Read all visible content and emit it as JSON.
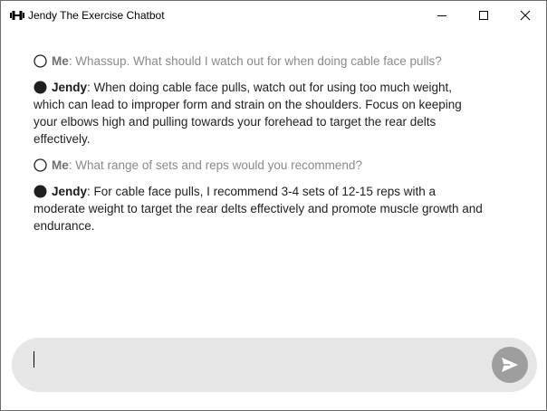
{
  "window": {
    "title": "Jendy The Exercise Chatbot"
  },
  "colors": {
    "user_text": "#8a8a8a",
    "bot_text": "#1f1f1f",
    "input_bg": "#e6e6e6",
    "send_button": "#9e9e9e"
  },
  "messages": [
    {
      "sender": "Me",
      "separator": ": ",
      "text": "Whassup. What should I watch out for when doing cable face pulls?",
      "marker": "hollow-circle-icon"
    },
    {
      "sender": "Jendy",
      "separator": ": ",
      "text": "When doing cable face pulls, watch out for using too much weight, which can lead to improper form and strain on the shoulders. Focus on keeping your elbows high and pulling towards your forehead to target the rear delts effectively.",
      "marker": "filled-circle-icon"
    },
    {
      "sender": "Me",
      "separator": ": ",
      "text": "What range of sets and reps would you recommend?",
      "marker": "hollow-circle-icon"
    },
    {
      "sender": "Jendy",
      "separator": ": ",
      "text": "For cable face pulls, I recommend 3-4 sets of 12-15 reps with a moderate weight to target the rear delts effectively and promote muscle growth and endurance.",
      "marker": "filled-circle-icon"
    }
  ],
  "input": {
    "value": "",
    "placeholder": ""
  }
}
